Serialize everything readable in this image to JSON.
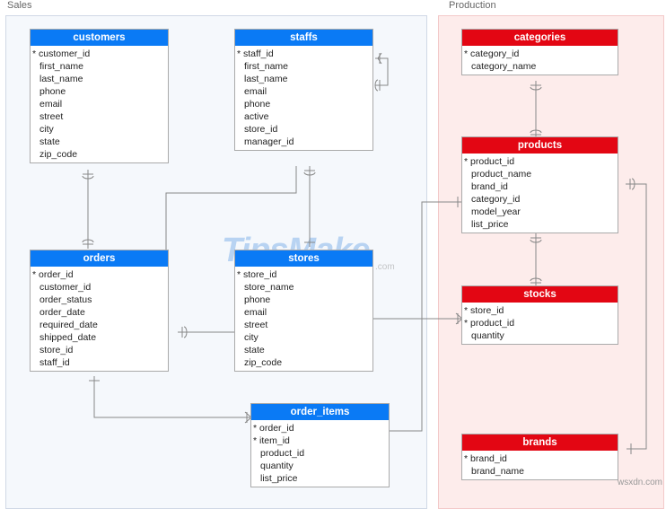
{
  "schemas": {
    "sales": {
      "label": "Sales"
    },
    "production": {
      "label": "Production"
    }
  },
  "entities": {
    "customers": {
      "title": "customers",
      "fields": [
        {
          "name": "customer_id",
          "pk": true
        },
        {
          "name": "first_name"
        },
        {
          "name": "last_name"
        },
        {
          "name": "phone"
        },
        {
          "name": "email"
        },
        {
          "name": "street"
        },
        {
          "name": "city"
        },
        {
          "name": "state"
        },
        {
          "name": "zip_code"
        }
      ]
    },
    "staffs": {
      "title": "staffs",
      "fields": [
        {
          "name": "staff_id",
          "pk": true
        },
        {
          "name": "first_name"
        },
        {
          "name": "last_name"
        },
        {
          "name": "email"
        },
        {
          "name": "phone"
        },
        {
          "name": "active"
        },
        {
          "name": "store_id"
        },
        {
          "name": "manager_id"
        }
      ]
    },
    "orders": {
      "title": "orders",
      "fields": [
        {
          "name": "order_id",
          "pk": true
        },
        {
          "name": "customer_id"
        },
        {
          "name": "order_status"
        },
        {
          "name": "order_date"
        },
        {
          "name": "required_date"
        },
        {
          "name": "shipped_date"
        },
        {
          "name": "store_id"
        },
        {
          "name": "staff_id"
        }
      ]
    },
    "stores": {
      "title": "stores",
      "fields": [
        {
          "name": "store_id",
          "pk": true
        },
        {
          "name": "store_name"
        },
        {
          "name": "phone"
        },
        {
          "name": "email"
        },
        {
          "name": "street"
        },
        {
          "name": "city"
        },
        {
          "name": "state"
        },
        {
          "name": "zip_code"
        }
      ]
    },
    "order_items": {
      "title": "order_items",
      "fields": [
        {
          "name": "order_id",
          "pk": true
        },
        {
          "name": "item_id",
          "pk": true
        },
        {
          "name": "product_id"
        },
        {
          "name": "quantity"
        },
        {
          "name": "list_price"
        }
      ]
    },
    "categories": {
      "title": "categories",
      "fields": [
        {
          "name": "category_id",
          "pk": true
        },
        {
          "name": "category_name"
        }
      ]
    },
    "products": {
      "title": "products",
      "fields": [
        {
          "name": "product_id",
          "pk": true
        },
        {
          "name": "product_name"
        },
        {
          "name": "brand_id"
        },
        {
          "name": "category_id"
        },
        {
          "name": "model_year"
        },
        {
          "name": "list_price"
        }
      ]
    },
    "stocks": {
      "title": "stocks",
      "fields": [
        {
          "name": "store_id",
          "pk": true
        },
        {
          "name": "product_id",
          "pk": true
        },
        {
          "name": "quantity"
        }
      ]
    },
    "brands": {
      "title": "brands",
      "fields": [
        {
          "name": "brand_id",
          "pk": true
        },
        {
          "name": "brand_name"
        }
      ]
    }
  },
  "watermark": {
    "main": "TipsMake",
    "sub": ".com"
  },
  "footer": {
    "credit": "wsxdn.com"
  }
}
